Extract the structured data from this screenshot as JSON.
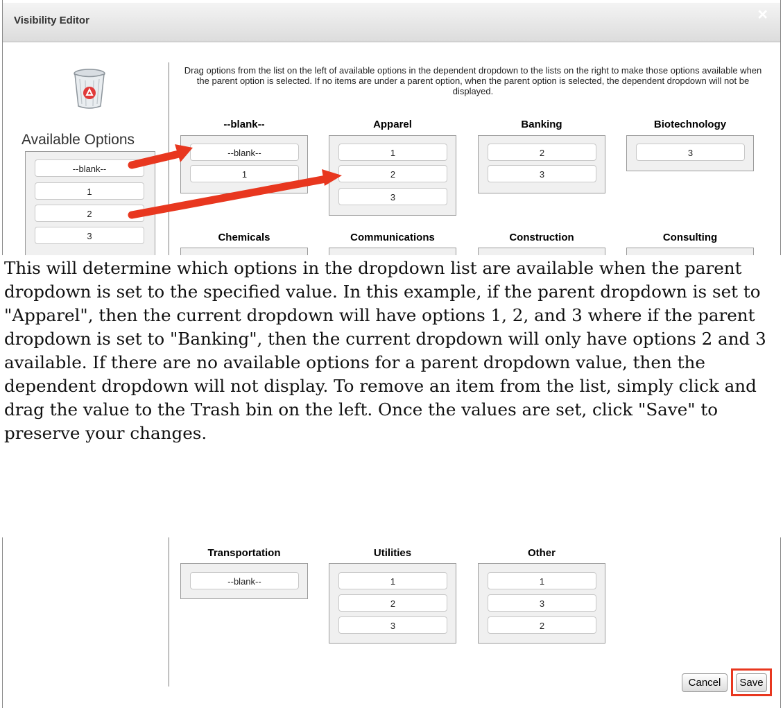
{
  "dialog": {
    "title": "Visibility Editor",
    "close_glyph": "×"
  },
  "instructions": "Drag options from the list on the left of available options in the dependent dropdown to the lists on the right to make those options available when the parent option is selected. If no items are under a parent option, when the parent option is selected, the dependent dropdown will not be displayed.",
  "trash": {
    "icon": "trash-bin-icon"
  },
  "available": {
    "title": "Available Options",
    "items": [
      "--blank--",
      "1",
      "2",
      "3"
    ]
  },
  "groups_row1": [
    {
      "name": "--blank--",
      "items": [
        "--blank--",
        "1"
      ]
    },
    {
      "name": "Apparel",
      "items": [
        "1",
        "2",
        "3"
      ]
    },
    {
      "name": "Banking",
      "items": [
        "2",
        "3"
      ]
    },
    {
      "name": "Biotechnology",
      "items": [
        "3"
      ]
    }
  ],
  "groups_row2": [
    {
      "name": "Chemicals"
    },
    {
      "name": "Communications"
    },
    {
      "name": "Construction"
    },
    {
      "name": "Consulting"
    }
  ],
  "groups_bottom": [
    {
      "name": "Transportation",
      "items": [
        "--blank--"
      ]
    },
    {
      "name": "Utilities",
      "items": [
        "1",
        "2",
        "3"
      ]
    },
    {
      "name": "Other",
      "items": [
        "1",
        "3",
        "2"
      ]
    }
  ],
  "description": "This will determine which options in the dropdown list are available when the parent dropdown is set to the specified value. In this example, if the parent dropdown is set to \"Apparel\", then the current dropdown will have options 1, 2, and 3 where if the parent dropdown is set to \"Banking\", then the current dropdown will only have options 2 and 3 available. If there are no available options for a parent dropdown value, then the dependent dropdown will not display. To remove an item from the list, simply click and drag the value to the Trash bin on the left. Once the values are set, click \"Save\" to preserve your changes.",
  "buttons": {
    "cancel": "Cancel",
    "save": "Save"
  },
  "colors": {
    "annotation_red": "#e8371f"
  }
}
